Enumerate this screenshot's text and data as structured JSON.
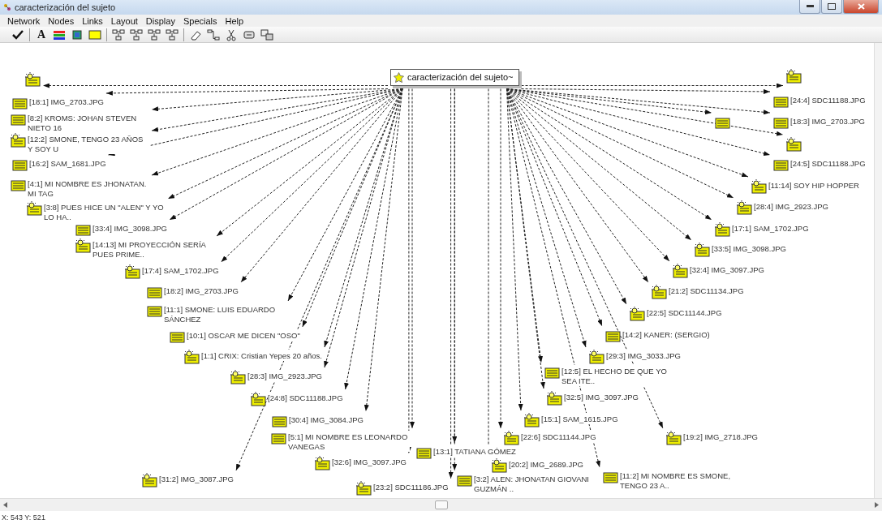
{
  "window": {
    "title": "caracterización del sujeto"
  },
  "menu": [
    "Network",
    "Nodes",
    "Links",
    "Layout",
    "Display",
    "Specials",
    "Help"
  ],
  "toolbar": [
    {
      "kind": "check"
    },
    {
      "kind": "separator"
    },
    {
      "kind": "font",
      "label": "A"
    },
    {
      "kind": "colors"
    },
    {
      "kind": "picture"
    },
    {
      "kind": "fill"
    },
    {
      "kind": "separator"
    },
    {
      "kind": "layout"
    },
    {
      "kind": "layout"
    },
    {
      "kind": "layout"
    },
    {
      "kind": "layout"
    },
    {
      "kind": "separator"
    },
    {
      "kind": "eraser"
    },
    {
      "kind": "link"
    },
    {
      "kind": "cut"
    },
    {
      "kind": "comment"
    },
    {
      "kind": "copy"
    }
  ],
  "hub": {
    "label": "caracterización del sujeto~"
  },
  "nodes": [
    {
      "kind": "image"
    },
    {
      "kind": "text",
      "label": "[18:1] IMG_2703.JPG"
    },
    {
      "kind": "text",
      "label": "[8:2] KROMS: JOHAN STEVEN NIETO 16"
    },
    {
      "kind": "image",
      "label": "[12:2] SMONE, TENGO 23 AÑOS Y SOY U"
    },
    {
      "kind": "text",
      "label": "[16:2] SAM_1681.JPG"
    },
    {
      "kind": "text",
      "label": "[4:1] MI NOMBRE ES JHONATAN. MI TAG"
    },
    {
      "kind": "image",
      "label": "[3:8] PUES HICE UN \"ALEN\" Y YO LO HA.."
    },
    {
      "kind": "text",
      "label": "[33:4] IMG_3098.JPG"
    },
    {
      "kind": "image",
      "label": "[14:13] MI PROYECCIÓN SERÍA PUES PRIME.."
    },
    {
      "kind": "image",
      "label": "[17:4] SAM_1702.JPG"
    },
    {
      "kind": "text",
      "label": "[18:2] IMG_2703.JPG"
    },
    {
      "kind": "text",
      "label": "[11:1] SMONE: LUIS EDUARDO SÁNCHEZ"
    },
    {
      "kind": "text",
      "label": "[10:1] OSCAR ME DICEN \"OSO\""
    },
    {
      "kind": "image",
      "label": "[1:1] CRIX: Cristian Yepes 20 años."
    },
    {
      "kind": "image",
      "label": "[28:3] IMG_2923.JPG"
    },
    {
      "kind": "image",
      "label": "[24:8] SDC11188.JPG"
    },
    {
      "kind": "text",
      "label": "[30:4] IMG_3084.JPG"
    },
    {
      "kind": "text",
      "label": "[5:1] MI NOMBRE ES LEONARDO VANEGAS"
    },
    {
      "kind": "image",
      "label": "[32:6] IMG_3097.JPG"
    },
    {
      "kind": "image"
    },
    {
      "kind": "text",
      "label": "[24:4] SDC11188.JPG"
    },
    {
      "kind": "text"
    },
    {
      "kind": "text",
      "label": "[18:3] IMG_2703.JPG"
    },
    {
      "kind": "image"
    },
    {
      "kind": "text",
      "label": "[24:5] SDC11188.JPG"
    },
    {
      "kind": "image",
      "label": "[11:14] SOY HIP HOPPER"
    },
    {
      "kind": "image",
      "label": "[28:4] IMG_2923.JPG"
    },
    {
      "kind": "image",
      "label": "[17:1] SAM_1702.JPG"
    },
    {
      "kind": "image",
      "label": "[33:5] IMG_3098.JPG"
    },
    {
      "kind": "image",
      "label": "[32:4] IMG_3097.JPG"
    },
    {
      "kind": "image",
      "label": "[21:2] SDC11134.JPG"
    },
    {
      "kind": "image",
      "label": "[22:5] SDC11144.JPG"
    },
    {
      "kind": "text",
      "label": "[14:2] KANER: (SERGIO)"
    },
    {
      "kind": "image",
      "label": "[29:3] IMG_3033.JPG"
    },
    {
      "kind": "text",
      "label": "[12:5] EL HECHO DE QUE YO SEA ITE.."
    },
    {
      "kind": "image",
      "label": "[32:5] IMG_3097.JPG"
    },
    {
      "kind": "image",
      "label": "[15:1] SAM_1615.JPG"
    },
    {
      "kind": "image",
      "label": "[22:6] SDC11144.JPG"
    },
    {
      "kind": "image",
      "label": "[19:2] IMG_2718.JPG"
    },
    {
      "kind": "text",
      "label": "[13:1] TATIANA GÓMEZ"
    },
    {
      "kind": "image",
      "label": "[20:2] IMG_2689.JPG"
    },
    {
      "kind": "image",
      "label": "[31:2] IMG_3087.JPG"
    },
    {
      "kind": "image",
      "label": "[23:2] SDC11186.JPG"
    },
    {
      "kind": "text",
      "label": "[3:2] ALEN: JHONATAN GIOVANI GUZMÁN .."
    },
    {
      "kind": "text",
      "label": "[11:2] MI NOMBRE ES SMONE, TENGO 23 A.."
    }
  ],
  "status_bar": "X: 543 Y: 521"
}
